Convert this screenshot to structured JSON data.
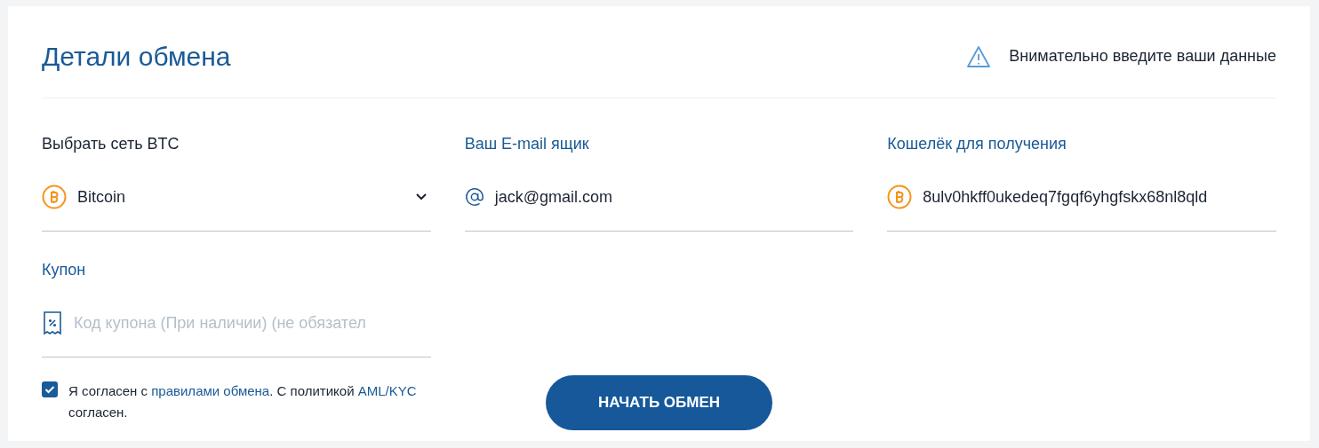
{
  "title": "Детали обмена",
  "notice": "Внимательно введите ваши данные",
  "fields": [
    {
      "kind": "select",
      "label": "Выбрать сеть BTC",
      "value": "Bitcoin"
    },
    {
      "kind": "email",
      "label": "Ваш E-mail ящик",
      "value": "jack@gmail.com"
    },
    {
      "kind": "wallet",
      "label": "Кошелёк для получения",
      "value": "8ulv0hkff0ukedeq7fgqf6yhgfskx68nl8qld"
    },
    {
      "kind": "coupon",
      "label": "Купон",
      "placeholder": "Код купона (При наличии) (не обязател"
    }
  ],
  "agreement": {
    "checked": true,
    "parts": [
      {
        "text": "Я согласен с ",
        "link": false
      },
      {
        "text": "правилами обмена",
        "link": true
      },
      {
        "text": ". С политикой ",
        "link": false
      },
      {
        "text": "AML/KYC",
        "link": true
      },
      {
        "text": " согласен.",
        "link": false
      }
    ]
  },
  "submit": "НАЧАТЬ ОБМЕН"
}
